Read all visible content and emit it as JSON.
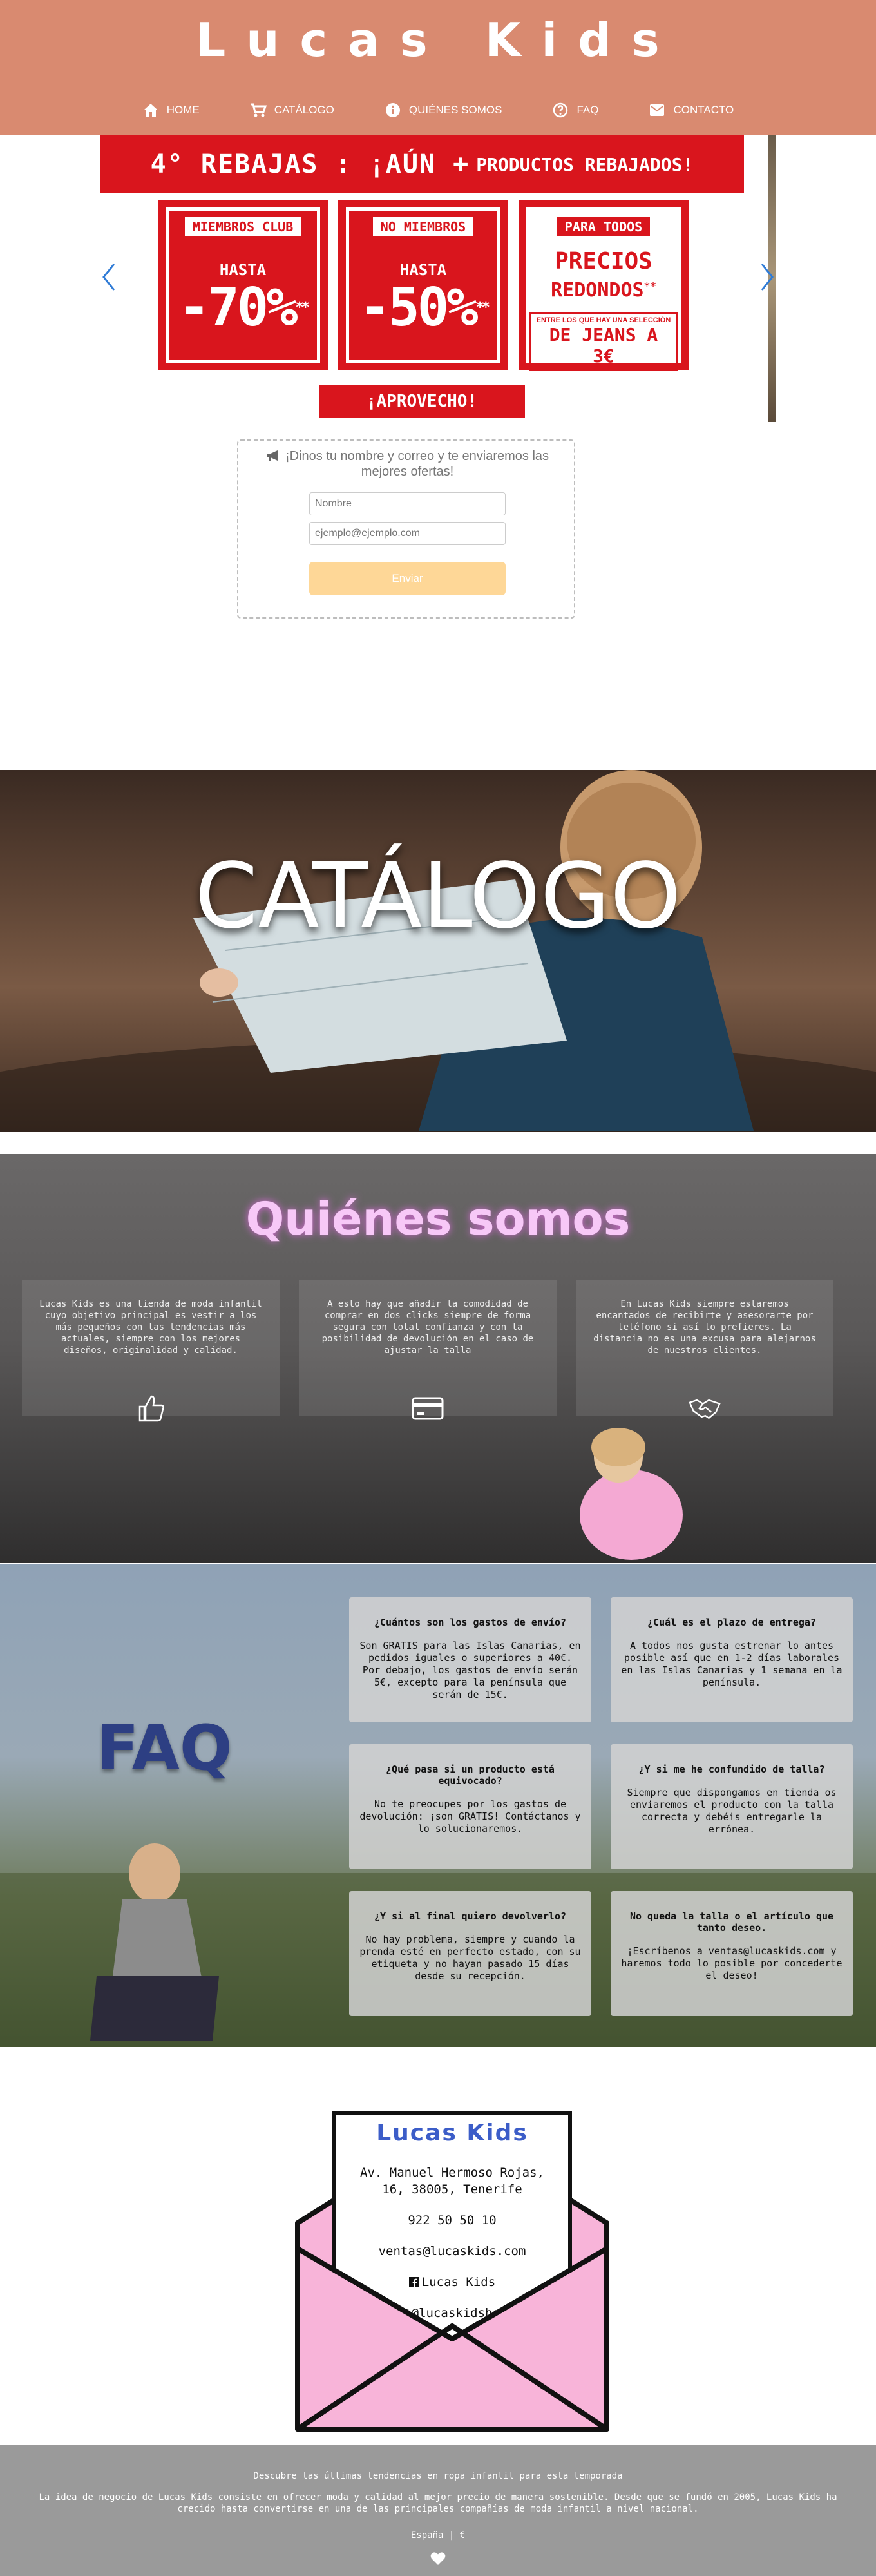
{
  "brand": "Lucas Kids",
  "nav": [
    {
      "label": "HOME",
      "icon": "home-icon"
    },
    {
      "label": "CATÁLOGO",
      "icon": "cart-icon"
    },
    {
      "label": "QUIÉNES SOMOS",
      "icon": "info-icon"
    },
    {
      "label": "FAQ",
      "icon": "question-icon"
    },
    {
      "label": "CONTACTO",
      "icon": "mail-icon"
    }
  ],
  "promo": {
    "title_big": "4° REBAJAS : ¡AÚN +",
    "title_small": "PRODUCTOS REBAJADOS!",
    "cards": [
      {
        "head": "MIEMBROS CLUB",
        "hasta": "HASTA",
        "pct": "-70%",
        "mark": "**"
      },
      {
        "head": "NO MIEMBROS",
        "hasta": "HASTA",
        "pct": "-50%",
        "mark": "**"
      },
      {
        "head": "PARA TODOS",
        "line1": "PRECIOS",
        "line2": "REDONDOS",
        "mark": "**",
        "note": "ENTRE LOS QUE HAY UNA SELECCIÓN",
        "jeans": "DE JEANS A 3€"
      }
    ],
    "cta": "¡APROVECHO!"
  },
  "newsletter": {
    "text": "¡Dinos tu nombre y correo y te enviaremos las mejores ofertas!",
    "name_placeholder": "Nombre",
    "email_placeholder": "ejemplo@ejemplo.com",
    "send_label": "Enviar"
  },
  "catalog": {
    "title": "CATÁLOGO"
  },
  "about": {
    "title": "Quiénes somos",
    "boxes": [
      {
        "text": "Lucas Kids es una tienda de moda infantil cuyo objetivo principal es vestir a los más pequeños con las tendencias más actuales, siempre con los mejores diseños, originalidad y calidad.",
        "icon": "thumbs-up-icon"
      },
      {
        "text": "A esto hay que añadir la comodidad de comprar en dos clicks siempre de forma segura con total confianza y con la posibilidad de devolución en el caso de ajustar la talla",
        "icon": "credit-card-icon"
      },
      {
        "text": "En Lucas Kids siempre estaremos encantados de recibirte y asesorarte por teléfono si así lo prefieres. La distancia no es una excusa para alejarnos de nuestros clientes.",
        "icon": "handshake-icon"
      }
    ]
  },
  "faq": {
    "title": "FAQ",
    "items": [
      {
        "q": "¿Cuántos son los gastos de envío?",
        "a": "Son GRATIS para las Islas Canarias, en pedidos iguales o superiores a 40€. Por debajo, los gastos de envío serán 5€, excepto para la península que serán de 15€."
      },
      {
        "q": "¿Cuál es el plazo de entrega?",
        "a": "A todos nos gusta estrenar lo antes posible así que en 1-2 días laborales en las Islas Canarias y 1 semana en la península."
      },
      {
        "q": "¿Qué pasa si un producto está equivocado?",
        "a": "No te preocupes por los gastos de devolución: ¡son GRATIS! Contáctanos y lo solucionaremos."
      },
      {
        "q": "¿Y si me he confundido de talla?",
        "a": "Siempre que dispongamos en tienda os enviaremos el producto con la talla correcta y debéis entregarle la errónea."
      },
      {
        "q": "¿Y si al final quiero devolverlo?",
        "a": "No hay problema, siempre y cuando la prenda esté en perfecto estado, con su etiqueta y no hayan pasado 15 días desde su recepción."
      },
      {
        "q": "No queda la talla o el artículo que tanto deseo.",
        "a": "¡Escríbenos a ventas@lucaskids.com y haremos todo lo posible por concederte el deseo!"
      }
    ]
  },
  "contact": {
    "brand": "Lucas Kids",
    "address": "Av. Manuel Hermoso Rojas, 16, 38005, Tenerife",
    "phone": "922 50 50 10",
    "email": "ventas@lucaskids.com",
    "facebook": "Lucas Kids",
    "twitter": "@lucaskidshop"
  },
  "footer": {
    "tagline": "Descubre las últimas tendencias en ropa infantil para esta temporada",
    "description": "La idea de negocio de Lucas Kids consiste en ofrecer moda y calidad al mejor precio de manera sostenible. Desde que se fundó en 2005, Lucas Kids ha crecido hasta convertirse en una de las principales compañías de moda infantil a nivel nacional.",
    "locale": "España | €"
  },
  "colors": {
    "header": "#d98a70",
    "promo_red": "#d9151d",
    "send_button": "#fed797",
    "faq_title": "#2d3f83",
    "footer": "#9a9a9a",
    "envelope_pink": "#f8b4d9"
  }
}
